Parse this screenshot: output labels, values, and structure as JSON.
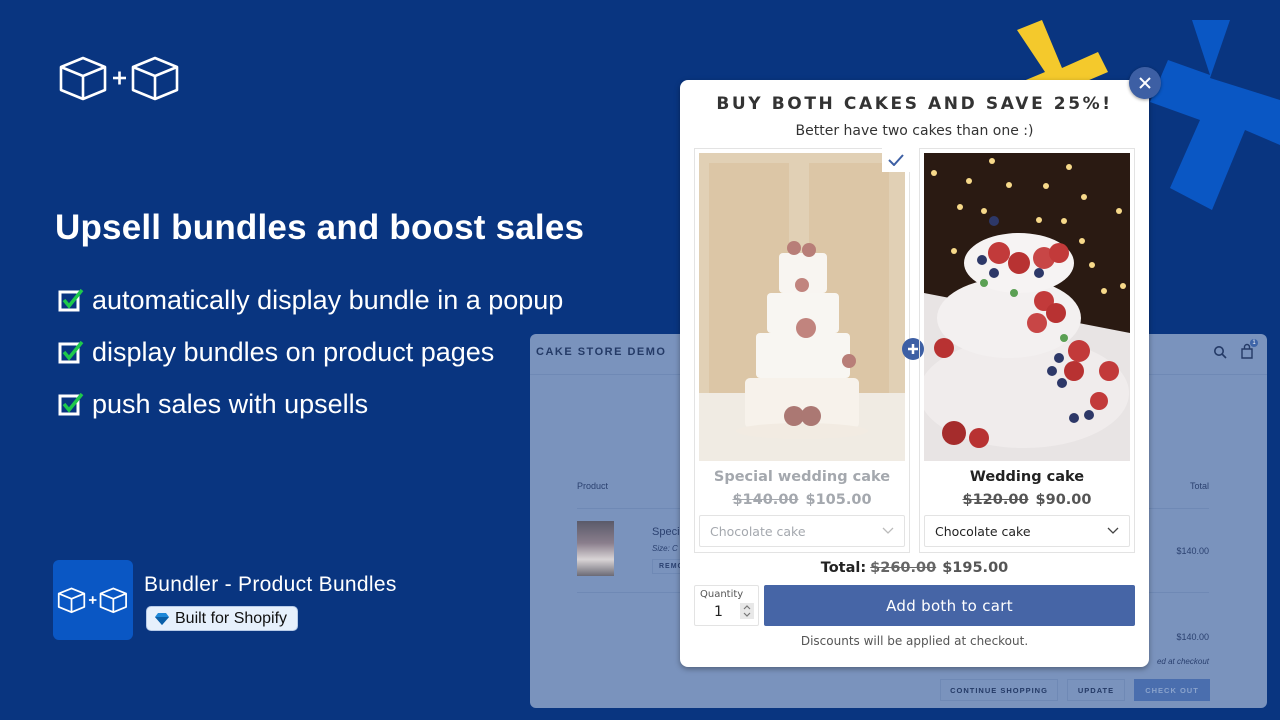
{
  "brand": {
    "logo_icon": "box-plus-box-icon",
    "headline": "Upsell bundles and boost sales",
    "features": [
      {
        "icon": "checked-box-icon",
        "label": "automatically display bundle in a popup"
      },
      {
        "icon": "checked-box-icon",
        "label": "display bundles on product pages"
      },
      {
        "icon": "checked-box-icon",
        "label": "push sales with upsells"
      }
    ],
    "app_name": "Bundler - Product Bundles",
    "badge_label": "Built for Shopify",
    "badge_icon": "diamond-icon"
  },
  "colors": {
    "background": "#093580",
    "accent_yellow": "#f4c92c",
    "accent_blue": "#0a57c4",
    "button_blue": "#4665a6",
    "check_green": "#1ec94b"
  },
  "store": {
    "title": "CAKE STORE DEMO",
    "cart_count": "1",
    "columns": {
      "product": "Product",
      "total": "Total"
    },
    "item": {
      "name": "Speci",
      "size": "Size: C",
      "remove_label": "REMO",
      "price": "$140.00"
    },
    "subtotal": "$140.00",
    "note": "ed at checkout",
    "buttons": {
      "continue": "CONTINUE SHOPPING",
      "update": "UPDATE",
      "checkout": "CHECK OUT"
    }
  },
  "popup": {
    "title": "BUY BOTH CAKES AND SAVE 25%!",
    "subtitle": "Better have two cakes than one :)",
    "products": [
      {
        "name": "Special wedding cake",
        "old_price": "$140.00",
        "new_price": "$105.00",
        "variant": "Chocolate cake",
        "selected": true
      },
      {
        "name": "Wedding cake",
        "old_price": "$120.00",
        "new_price": "$90.00",
        "variant": "Chocolate cake",
        "selected": false
      }
    ],
    "total_label": "Total:",
    "total_old": "$260.00",
    "total_new": "$195.00",
    "quantity_label": "Quantity",
    "quantity_value": "1",
    "add_button": "Add both to cart",
    "disclaimer": "Discounts will be applied at checkout."
  }
}
